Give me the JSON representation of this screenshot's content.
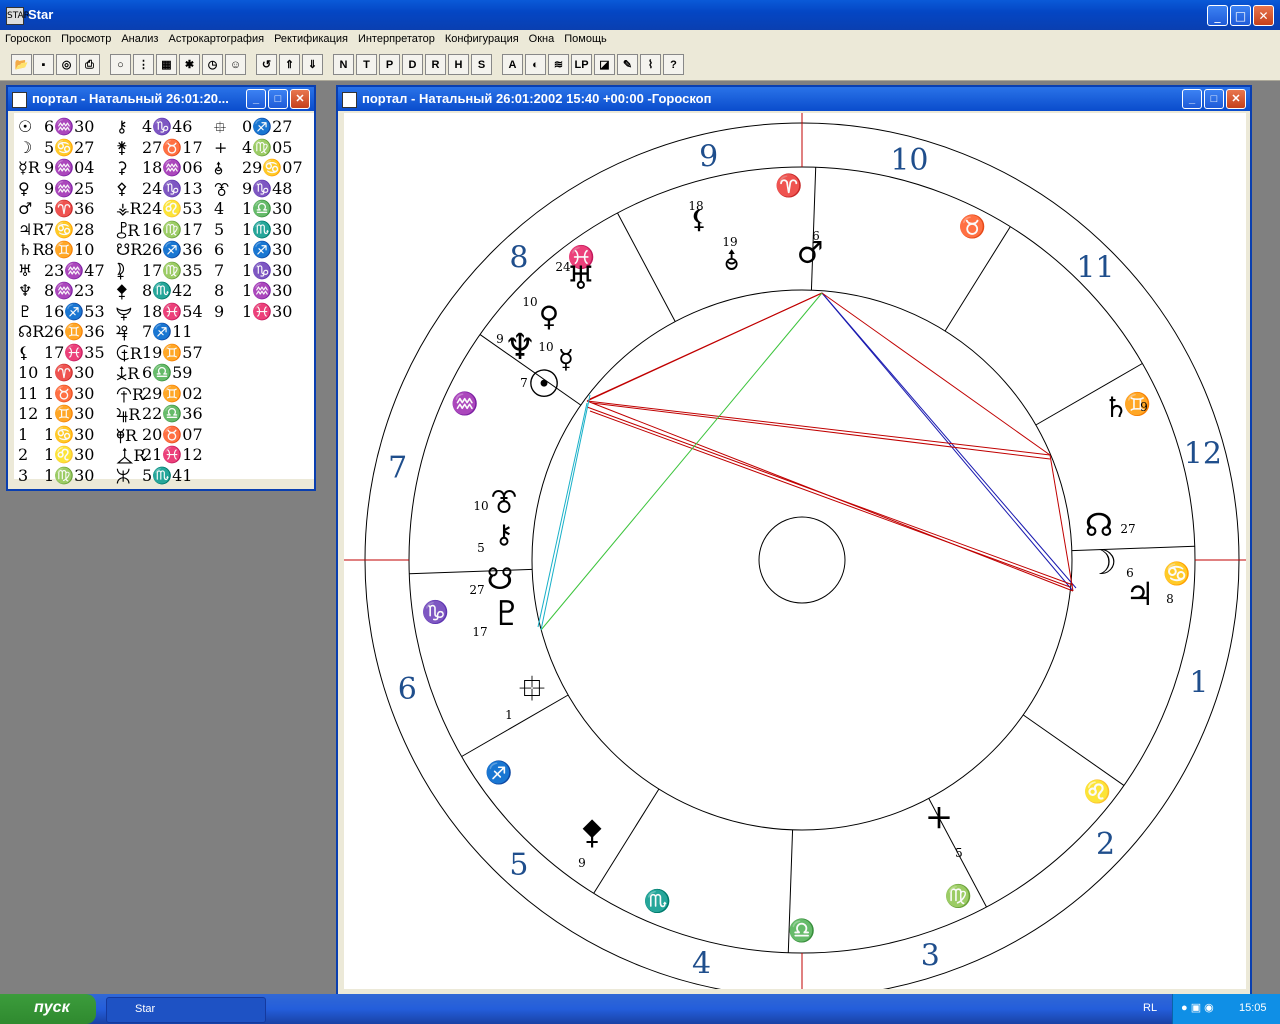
{
  "app": {
    "title": "Star",
    "icon_label": "STAR"
  },
  "menu": [
    "Гороскоп",
    "Просмотр",
    "Анализ",
    "Астрокартография",
    "Ректификация",
    "Интерпретатор",
    "Конфигурация",
    "Окна",
    "Помощь"
  ],
  "toolbar": {
    "icons": [
      "open-icon",
      "save-icon",
      "target-icon",
      "print-icon",
      "disc-icon",
      "grid-icon",
      "table-icon",
      "aspect-star-icon",
      "clock-icon",
      "people-icon",
      "rotate-icon",
      "up-icon",
      "down-icon"
    ],
    "letters": [
      "N",
      "T",
      "P",
      "D",
      "R",
      "H",
      "S"
    ],
    "icons2": [
      "ab-icon",
      "moon-phase-icon",
      "lines-icon",
      "lp-label",
      "dice-icon",
      "pen-icon",
      "graph-icon",
      "help-icon"
    ],
    "lp_label": "LP",
    "help_label": "?"
  },
  "list_window": {
    "title": "портал - Натальный 26:01:20...",
    "rows": [
      [
        "☉",
        "6♒30",
        "⚷",
        "4♑46",
        "⯐",
        "0♐27"
      ],
      [
        "☽",
        "5♋27",
        "⚵",
        "27♉17",
        "+",
        "4♍05"
      ],
      [
        "☿R",
        "9♒04",
        "⚳",
        "18♒06",
        "⯗",
        "29♋07"
      ],
      [
        "♀",
        "9♒25",
        "⚴",
        "24♑13",
        "⯔",
        "9♑48"
      ],
      [
        "♂",
        "5♈36",
        "⚶R",
        "24♌53",
        "4",
        "1♎30"
      ],
      [
        "♃R",
        "7♋28",
        "⯛R",
        "16♍17",
        "5",
        "1♏30"
      ],
      [
        "♄R",
        "8♊10",
        "☋R",
        "26♐36",
        "6",
        "1♐30"
      ],
      [
        "♅",
        "23♒47",
        "⯝",
        "17♍35",
        "7",
        "1♑30"
      ],
      [
        "♆",
        "8♒23",
        "⯞",
        "8♏42",
        "8",
        "1♒30"
      ],
      [
        "♇",
        "16♐53",
        "⯟",
        "18♓54",
        "9",
        "1♓30"
      ],
      [
        "☊R",
        "26♊36",
        "⯠",
        "7♐11",
        "",
        ""
      ],
      [
        "⚸",
        "17♓35",
        "⯡R",
        "19♊57",
        "",
        ""
      ],
      [
        "10",
        "1♈30",
        "⯢R",
        "6♎59",
        "",
        ""
      ],
      [
        "11",
        "1♉30",
        "⯣R",
        "29♊02",
        "",
        ""
      ],
      [
        "12",
        "1♊30",
        "⯤R",
        "22♎36",
        "",
        ""
      ],
      [
        "1",
        "1♋30",
        "⯥R",
        "20♉07",
        "",
        ""
      ],
      [
        "2",
        "1♌30",
        "⯦R",
        "21♓12",
        "",
        ""
      ],
      [
        "3",
        "1♍30",
        "⯧",
        "5♏41",
        "",
        ""
      ]
    ]
  },
  "chart_window": {
    "title": "портал - Натальный 26:01:2002  15:40 +00:00 -Гороскоп",
    "houses": [
      "9",
      "10",
      "11",
      "12",
      "1",
      "2",
      "3",
      "4",
      "5",
      "6",
      "7",
      "8"
    ],
    "signs": [
      "♈",
      "♉",
      "♊",
      "♋",
      "♌",
      "♍",
      "♎",
      "♏",
      "♐",
      "♑",
      "♒",
      "♓"
    ],
    "planets": [
      {
        "glyph": "⚸",
        "deg": "18"
      },
      {
        "glyph": "⯗",
        "deg": "19"
      },
      {
        "glyph": "♂",
        "deg": "6"
      },
      {
        "glyph": "♅",
        "deg": "24"
      },
      {
        "glyph": "♀",
        "deg": "10"
      },
      {
        "glyph": "♆",
        "deg": "9"
      },
      {
        "glyph": "☿",
        "deg": "10"
      },
      {
        "glyph": "☉",
        "deg": "7"
      },
      {
        "glyph": "♄",
        "deg": "9"
      },
      {
        "glyph": "☊",
        "deg": "27"
      },
      {
        "glyph": "☽",
        "deg": "6"
      },
      {
        "glyph": "♃",
        "deg": "8"
      },
      {
        "glyph": "⯔",
        "deg": "10"
      },
      {
        "glyph": "⚷",
        "deg": "5"
      },
      {
        "glyph": "☋",
        "deg": "27"
      },
      {
        "glyph": "♇",
        "deg": "17"
      },
      {
        "glyph": "⯐",
        "deg": "1"
      },
      {
        "glyph": "+",
        "deg": "5"
      },
      {
        "glyph": "⯞",
        "deg": "9"
      }
    ]
  },
  "taskbar": {
    "start": "пуск",
    "task": "Star",
    "lang": "RL",
    "clock": "15:05"
  },
  "colors": {
    "house_num": "#1f4e8c",
    "sign": "#5fb56f",
    "red": "#c00000",
    "blue": "#1a1ab0",
    "green": "#3cc43c",
    "cyan": "#18b0c8"
  }
}
